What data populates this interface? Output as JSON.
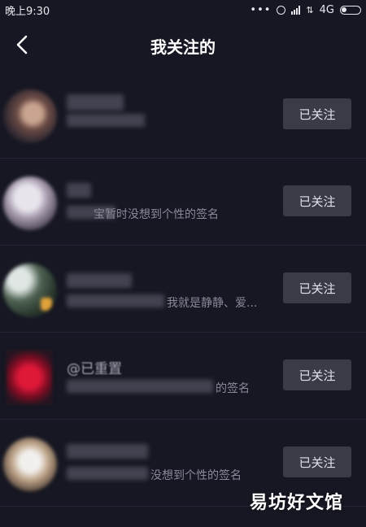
{
  "status_bar": {
    "time": "晚上9:30",
    "network": "4G",
    "more": "•••"
  },
  "nav": {
    "title": "我关注的"
  },
  "follow_list": [
    {
      "username": "",
      "signature": "",
      "button_label": "已关注"
    },
    {
      "username": "",
      "signature": "宝暂时没想到个性的签名",
      "button_label": "已关注"
    },
    {
      "username": "",
      "signature": "我就是静静、爱...",
      "button_label": "已关注"
    },
    {
      "username": "@已重置",
      "signature": "的签名",
      "button_label": "已关注"
    },
    {
      "username": "",
      "signature": "没想到个性的签名",
      "button_label": "已关注"
    }
  ],
  "watermark": "易坊好文馆"
}
